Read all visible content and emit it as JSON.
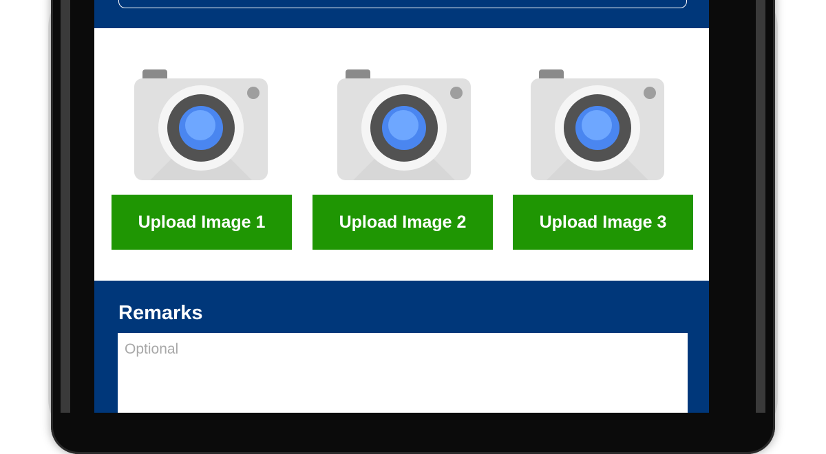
{
  "upload": {
    "items": [
      {
        "label": "Upload Image 1",
        "icon": "camera-icon"
      },
      {
        "label": "Upload Image 2",
        "icon": "camera-icon"
      },
      {
        "label": "Upload Image 3",
        "icon": "camera-icon"
      }
    ]
  },
  "remarks": {
    "label": "Remarks",
    "placeholder": "Optional"
  },
  "colors": {
    "brand_blue": "#00377a",
    "button_green": "#1f9603",
    "lens_blue": "#4a86f0"
  }
}
